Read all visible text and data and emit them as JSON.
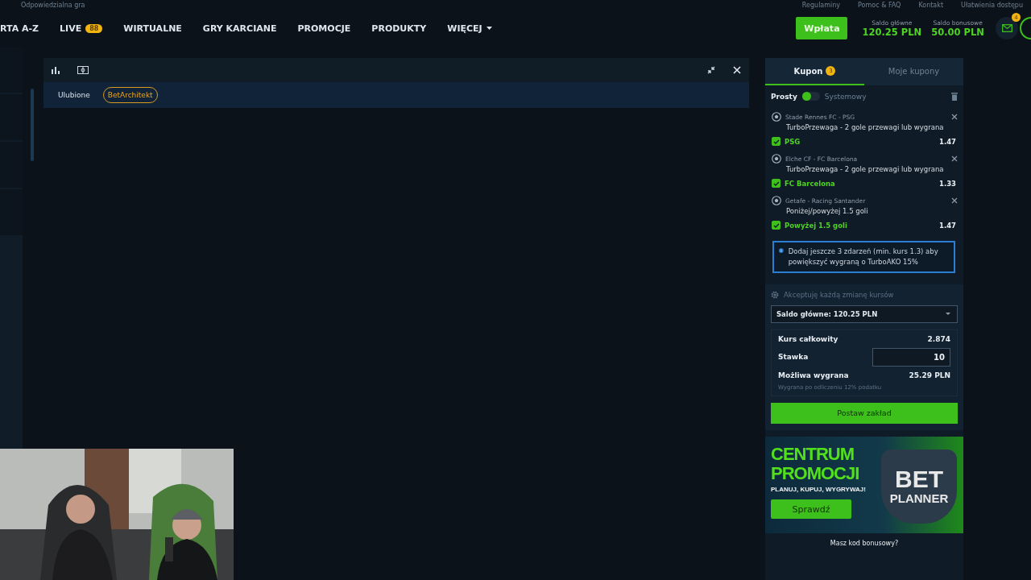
{
  "top_links": {
    "left": [
      "Odpowiedzialna gra"
    ],
    "right": [
      "Regulaminy",
      "Pomoc & FAQ",
      "Kontakt",
      "Ułatwienia dostępu"
    ]
  },
  "nav": {
    "items": [
      {
        "label": "RTA A-Z"
      },
      {
        "label": "LIVE",
        "badge": "88"
      },
      {
        "label": "WIRTUALNE"
      },
      {
        "label": "GRY KARCIANE"
      },
      {
        "label": "PROMOCJE"
      },
      {
        "label": "PRODUKTY"
      },
      {
        "label": "WIĘCEJ",
        "dropdown": true
      }
    ],
    "deposit": "Wpłata",
    "balances": [
      {
        "label": "Saldo główne",
        "value": "120.25 PLN"
      },
      {
        "label": "Saldo bonusowe",
        "value": "50.00 PLN"
      }
    ],
    "messages_badge": "4"
  },
  "panel": {
    "filters": [
      {
        "label": "Ulubione",
        "selected": false
      },
      {
        "label": "BetArchitekt",
        "selected": true
      }
    ]
  },
  "coupon": {
    "tabs": [
      {
        "label": "Kupon",
        "badge": "3",
        "selected": true
      },
      {
        "label": "Moje kupony",
        "selected": false
      }
    ],
    "mode_simple": "Prosty",
    "mode_system": "Systemowy",
    "system_on": false,
    "bets": [
      {
        "match": "Stade Rennes FC - PSG",
        "market": "TurboPrzewaga - 2 gole przewagi lub wygrana",
        "pick": "PSG",
        "odds": "1.47",
        "checked": true
      },
      {
        "match": "Elche CF - FC Barcelona",
        "market": "TurboPrzewaga - 2 gole przewagi lub wygrana",
        "pick": "FC Barcelona",
        "odds": "1.33",
        "checked": true
      },
      {
        "match": "Getafe - Racing Santander",
        "market": "Poniżej/powyżej 1.5 goli",
        "pick": "Powyżej 1.5 goli",
        "odds": "1.47",
        "checked": true
      }
    ],
    "info": "Dodaj jeszcze 3 zdarzeń (min. kurs 1.3) aby powiększyć wygraną o TurboAKO 15%",
    "accept_changes": "Akceptuję każdą zmianę kursów",
    "balance_select": "Saldo główne: 120.25 PLN",
    "total_label": "Kurs całkowity",
    "total_value": "2.874",
    "stake_label": "Stawka",
    "stake_value": "10",
    "win_label": "Możliwa wygrana",
    "win_value": "25.29 PLN",
    "tax_note": "Wygrana po odliczeniu 12% podatku",
    "place_bet": "Postaw zakład"
  },
  "banner": {
    "title_1": "CENTRUM",
    "title_2": "PROMOCJI",
    "slogan": "PLANUJ, KUPUJ, WYGRYWAJ!",
    "button": "Sprawdź",
    "logo_1": "BET",
    "logo_2": "PLANNER"
  },
  "bonus_code": "Masz kod bonusowy?"
}
